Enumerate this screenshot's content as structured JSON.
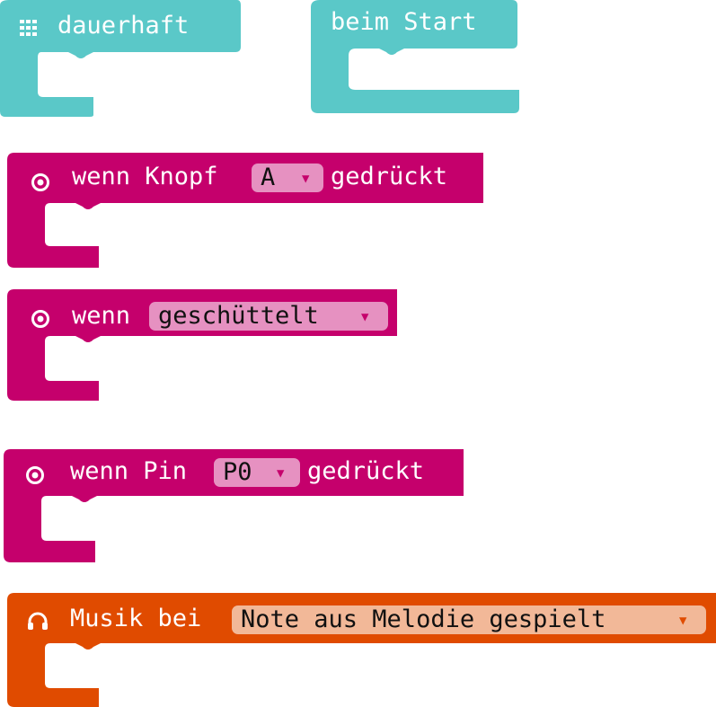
{
  "colors": {
    "basic": "#5ac8c8",
    "input": "#c5006c",
    "input_dropdown": "#e691c1",
    "music": "#e04b00",
    "music_dropdown": "#f2b898"
  },
  "blocks": {
    "forever": {
      "label": "dauerhaft",
      "icon": "grid-icon"
    },
    "on_start": {
      "label": "beim Start"
    },
    "button_pressed": {
      "prefix": "wenn Knopf",
      "dropdown_value": "A",
      "suffix": "gedrückt",
      "icon": "target-icon"
    },
    "gesture": {
      "prefix": "wenn",
      "dropdown_value": "geschüttelt",
      "icon": "target-icon"
    },
    "pin_pressed": {
      "prefix": "wenn Pin",
      "dropdown_value": "P0",
      "suffix": "gedrückt",
      "icon": "target-icon"
    },
    "music_event": {
      "prefix": "Musik bei",
      "dropdown_value": "Note aus Melodie gespielt",
      "icon": "headphones-icon"
    }
  }
}
